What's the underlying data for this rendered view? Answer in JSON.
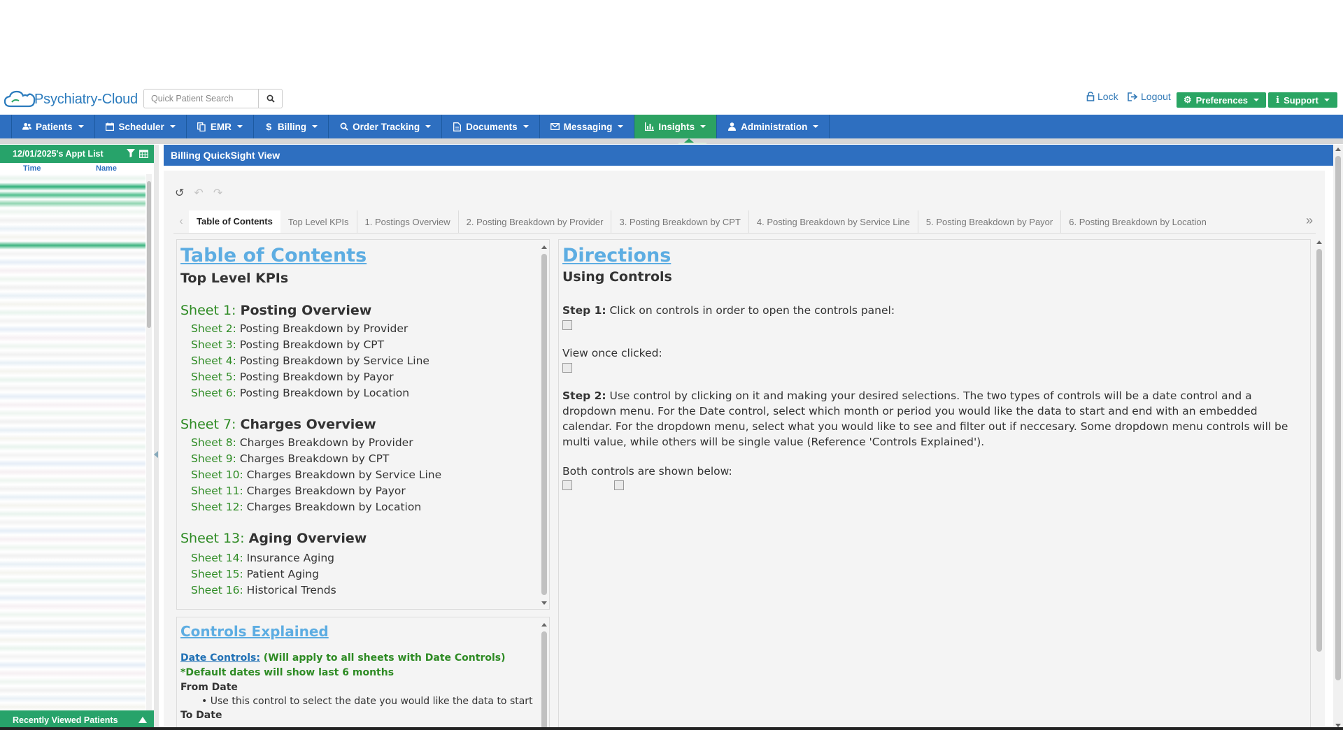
{
  "header": {
    "logo_text": "Psychiatry-Cloud",
    "search_placeholder": "Quick Patient Search",
    "lock_label": "Lock",
    "logout_label": "Logout",
    "preferences_label": "Preferences",
    "support_label": "Support"
  },
  "nav": {
    "items": [
      {
        "label": "Patients",
        "icon": "users-icon"
      },
      {
        "label": "Scheduler",
        "icon": "calendar-icon"
      },
      {
        "label": "EMR",
        "icon": "copy-icon"
      },
      {
        "label": "Billing",
        "icon": "dollar-icon"
      },
      {
        "label": "Order Tracking",
        "icon": "search-icon"
      },
      {
        "label": "Documents",
        "icon": "file-icon"
      },
      {
        "label": "Messaging",
        "icon": "envelope-icon"
      },
      {
        "label": "Insights",
        "icon": "bar-chart-icon",
        "active": true
      },
      {
        "label": "Administration",
        "icon": "user-icon"
      }
    ]
  },
  "sidebar": {
    "title": "12/01/2025's Appt List",
    "col_time": "Time",
    "col_name": "Name",
    "footer": "Recently Viewed Patients"
  },
  "main": {
    "title": "Billing QuickSight View",
    "tabs": [
      "Table of Contents",
      "Top Level KPIs",
      "1. Postings Overview",
      "2. Posting Breakdown by Provider",
      "3. Posting Breakdown by CPT",
      "4. Posting Breakdown by Service Line",
      "5. Posting Breakdown by Payor",
      "6. Posting Breakdown by Location"
    ]
  },
  "toc": {
    "title": "Table of Contents",
    "top_kpis": "Top Level KPIs",
    "s1_lbl": "Sheet 1:",
    "s1": "Posting Overview",
    "s2_lbl": "Sheet 2:",
    "s2": "Posting Breakdown by Provider",
    "s3_lbl": "Sheet 3:",
    "s3": "Posting Breakdown by CPT",
    "s4_lbl": "Sheet 4:",
    "s4": "Posting Breakdown by Service Line",
    "s5_lbl": "Sheet 5:",
    "s5": "Posting Breakdown by Payor",
    "s6_lbl": "Sheet 6:",
    "s6": "Posting Breakdown by Location",
    "s7_lbl": "Sheet 7:",
    "s7": "Charges Overview",
    "s8_lbl": "Sheet 8:",
    "s8": "Charges Breakdown by Provider",
    "s9_lbl": "Sheet 9:",
    "s9": "Charges Breakdown by CPT",
    "s10_lbl": "Sheet 10:",
    "s10": "Charges Breakdown by Service Line",
    "s11_lbl": "Sheet 11:",
    "s11": "Charges Breakdown by Payor",
    "s12_lbl": "Sheet 12:",
    "s12": "Charges Breakdown by Location",
    "s13_lbl": "Sheet 13:",
    "s13": "Aging Overview",
    "s14_lbl": "Sheet 14:",
    "s14": "Insurance Aging",
    "s15_lbl": "Sheet 15:",
    "s15": "Patient Aging",
    "s16_lbl": "Sheet 16:",
    "s16": "Historical Trends"
  },
  "controls": {
    "title": "Controls Explained",
    "date_link": "Date Controls:",
    "date_desc": " (Will apply to all sheets with Date Controls) *Default dates will show last 6 months",
    "from_date": "From Date",
    "from_desc": "Use this control to select the date you would like the data to start",
    "to_date": "To Date"
  },
  "directions": {
    "title": "Directions",
    "subtitle": "Using Controls",
    "step1_lbl": "Step 1:",
    "step1": " Click on controls in order to open the controls panel:",
    "view_once": "View once clicked:",
    "step2_lbl": "Step 2:",
    "step2": " Use control by clicking on it and making your desired selections. The two types of controls will be a date control and a dropdown menu. For the Date control, select which month or period you would like the data to start and end with an embedded calendar. For the dropdown menu, select what you would like to see and filter out if neccesary. Some dropdown menu controls will be multi value, while others will be single value (Reference 'Controls Explained').",
    "both": "Both controls are shown below:"
  },
  "colors": {
    "nav_blue": "#2e6fc0",
    "accent_green": "#2ca262",
    "link_blue": "#5dade2",
    "sheet_green": "#2e8b24"
  }
}
